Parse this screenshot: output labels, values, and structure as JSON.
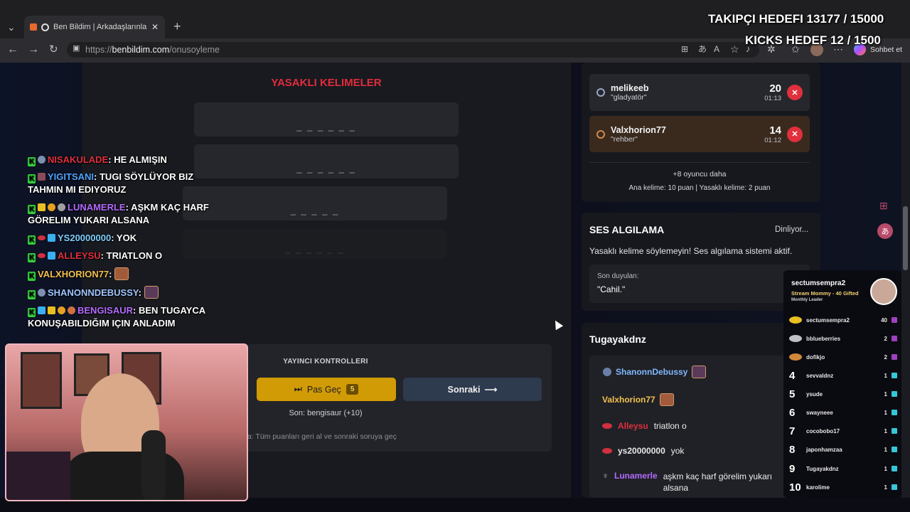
{
  "browser": {
    "tab_title": "Ben Bildim | Arkadaşlarınla Ön",
    "url_prefix": "https://",
    "url_host": "benbildim.com",
    "url_path": "/onusoyleme",
    "copilot_label": "Sohbet et"
  },
  "overlay": {
    "follower_goal": "TAKIPÇI HEDEFI 13177 / 15000",
    "kicks_goal": "KICKS HEDEF 12 / 1500"
  },
  "game": {
    "banned_title": "YASAKLI KELIMELER",
    "slots": [
      "_ _ _ _ _ _",
      "_ _ _ _ _ _",
      "_ _ _ _ _",
      "_ _ _ _ _ _"
    ],
    "controls_title": "YAYINCI KONTROLLERI",
    "pass_label": "Pas Geç",
    "pass_count": "5",
    "next_label": "Sonraki",
    "last_text": "Son: bengisaur (+10)",
    "hint": "ta: Tüm puanları geri al ve sonraki soruya geç"
  },
  "players": [
    {
      "name": "melikeeb",
      "word": "\"gladyatör\"",
      "score": "20",
      "time": "01:13"
    },
    {
      "name": "Valxhorion77",
      "word": "\"rehber\"",
      "score": "14",
      "time": "01:12"
    }
  ],
  "players_more": "+8 oyuncu daha",
  "scoring_note": "Ana kelime: 10 puan | Yasaklı kelime: 2 puan",
  "voice": {
    "title": "SES ALGILAMA",
    "status": "Dinliyor...",
    "desc": "Yasaklı kelime söylemeyin! Ses algılama sistemi aktif.",
    "heard_label": "Son duyulan:",
    "heard_value": "\"Cahil.\""
  },
  "room_chat": {
    "title": "Tugayakdnz",
    "messages": [
      {
        "user": "ShanonnDebussy",
        "text": "",
        "color": "#7fb7ff"
      },
      {
        "user": "Valxhorion77",
        "text": "",
        "color": "#f2c14e"
      },
      {
        "user": "Alleysu",
        "text": "triatlon o",
        "color": "#e0303d"
      },
      {
        "user": "ys20000000",
        "text": "yok",
        "color": "#7fb7ff"
      },
      {
        "user": "Lunamerle",
        "text": "aşkm kaç harf görelim yukarı alsana",
        "color": "#b36bff"
      }
    ]
  },
  "stream_chat": [
    {
      "user": "NISAKULADE",
      "sep": ":",
      "text": "HE ALMIŞIN",
      "color": "#e0303d"
    },
    {
      "user": "YIGITSANI",
      "sep": ":",
      "text": "TUGI SÖYLÜYOR BIZ TAHMIN MI EDIYORUZ",
      "color": "#4fa3ff"
    },
    {
      "user": "LUNAMERLE",
      "sep": ":",
      "text": "AŞKM KAÇ HARF GÖRELIM YUKARI ALSANA",
      "color": "#b36bff"
    },
    {
      "user": "YS20000000",
      "sep": ":",
      "text": "YOK",
      "color": "#7fd0ff"
    },
    {
      "user": "ALLEYSU",
      "sep": ":",
      "text": "TRIATLON O",
      "color": "#e0303d"
    },
    {
      "user": "VALXHORION77",
      "sep": ":",
      "text": "",
      "color": "#f2c14e"
    },
    {
      "user": "SHANONNDEBUSSY",
      "sep": ":",
      "text": "",
      "color": "#9fc5ff"
    },
    {
      "user": "BENGISAUR",
      "sep": ":",
      "text": "BEN TUGAYCA KONUŞABILDIĞIM IÇIN ANLADIM",
      "color": "#b36bff"
    }
  ],
  "leaderboard": {
    "top_name": "sectumsempra2",
    "top_sub": "Stream Mommy - 40 Gifted",
    "top_period": "Monthly Leader",
    "rows": [
      {
        "rank": "",
        "name": "sectumsempra2",
        "value": "40"
      },
      {
        "rank": "",
        "name": "bblueberries",
        "value": "2"
      },
      {
        "rank": "",
        "name": "dofikjo",
        "value": "2"
      },
      {
        "rank": "4",
        "name": "sevvaldnz",
        "value": "1"
      },
      {
        "rank": "5",
        "name": "ysude",
        "value": "1"
      },
      {
        "rank": "6",
        "name": "swayneee",
        "value": "1"
      },
      {
        "rank": "7",
        "name": "cocobobo17",
        "value": "1"
      },
      {
        "rank": "8",
        "name": "japonhamzaa",
        "value": "1"
      },
      {
        "rank": "9",
        "name": "Tugayakdnz",
        "value": "1"
      },
      {
        "rank": "10",
        "name": "karolime",
        "value": "1"
      }
    ]
  }
}
